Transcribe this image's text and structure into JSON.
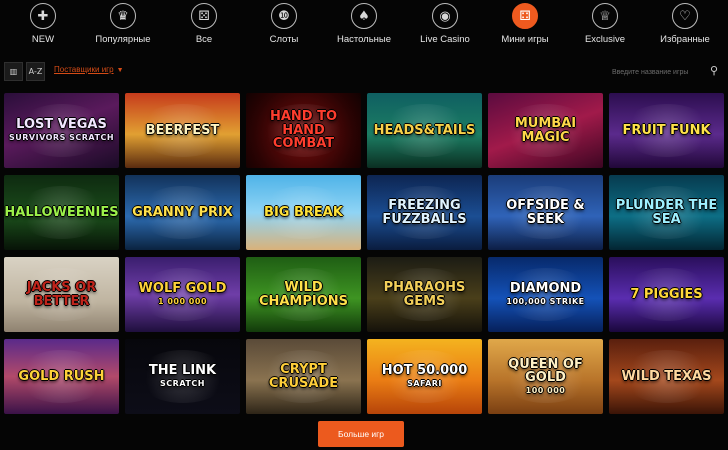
{
  "nav": {
    "items": [
      {
        "label": "NEW",
        "glyph": "✚"
      },
      {
        "label": "Популярные",
        "glyph": "♛"
      },
      {
        "label": "Все",
        "glyph": "⚄"
      },
      {
        "label": "Слоты",
        "glyph": "❿"
      },
      {
        "label": "Настольные",
        "glyph": "♠"
      },
      {
        "label": "Live Casino",
        "glyph": "◉"
      },
      {
        "label": "Мини игры",
        "glyph": "⚃"
      },
      {
        "label": "Exclusive",
        "glyph": "♕"
      },
      {
        "label": "Избранные",
        "glyph": "♡"
      }
    ],
    "active_index": 6,
    "accent_color": "#ee5a1f"
  },
  "toolbar": {
    "grid_view_icon": "grid-view-icon",
    "az_label": "A-Z",
    "sort_label": "Поставщики игр",
    "search_placeholder": "Введите название игры"
  },
  "games": [
    {
      "title": "Lost Vegas",
      "sub": "Survivors Scratch",
      "bg": "linear-gradient(160deg,#2a0e3a 0%,#5a1a5c 45%,#1a0b26 100%)",
      "color": "#f2e6ff"
    },
    {
      "title": "Beerfest",
      "sub": "",
      "bg": "linear-gradient(180deg,#c63b1c 0%,#e1a032 55%,#5a2b10 100%)",
      "color": "#fff4c0"
    },
    {
      "title": "Hand to Hand Combat",
      "sub": "",
      "bg": "radial-gradient(circle at 50% 55%,#7a0d0d 0%,#2b0303 70%,#120101 100%)",
      "color": "#ff3d2e"
    },
    {
      "title": "Heads&Tails",
      "sub": "",
      "bg": "linear-gradient(180deg,#0f5f62 0%,#1c7d63 55%,#0b2f22 100%)",
      "color": "#f7d24a"
    },
    {
      "title": "Mumbai Magic",
      "sub": "",
      "bg": "linear-gradient(160deg,#5b0b3f 0%,#a11a4a 50%,#3c0622 100%)",
      "color": "#ffd84a"
    },
    {
      "title": "Fruit Funk",
      "sub": "",
      "bg": "linear-gradient(180deg,#2c0e4f 0%,#5b2a8c 55%,#210838 100%)",
      "color": "#ffe24a"
    },
    {
      "title": "Halloweenies",
      "sub": "",
      "bg": "linear-gradient(180deg,#0e2a10 0%,#1b4d1b 55%,#071307 100%)",
      "color": "#9cf24a"
    },
    {
      "title": "Granny Prix",
      "sub": "",
      "bg": "linear-gradient(180deg,#12325a 0%,#2c6bb0 55%,#0b2340 100%)",
      "color": "#ffe14d"
    },
    {
      "title": "Big Break",
      "sub": "",
      "bg": "linear-gradient(180deg,#4fb3e8 0%,#8fd4f5 50%,#d9b27a 100%)",
      "color": "#ffe23a"
    },
    {
      "title": "Freezing Fuzzballs",
      "sub": "",
      "bg": "linear-gradient(180deg,#0d2552 0%,#1b4e93 55%,#0a1c3e 100%)",
      "color": "#dff3ff"
    },
    {
      "title": "Offside & Seek",
      "sub": "",
      "bg": "linear-gradient(180deg,#1b3d7a 0%,#2f63b8 55%,#0d1e45 100%)",
      "color": "#ffffff"
    },
    {
      "title": "Plunder the Sea",
      "sub": "",
      "bg": "linear-gradient(180deg,#073b4f 0%,#0d6e85 55%,#032532 100%)",
      "color": "#9ff0ff"
    },
    {
      "title": "Jacks or Better",
      "sub": "",
      "bg": "linear-gradient(180deg,#d9d2c4 0%,#bfb4a0 60%,#8f8270 100%)",
      "color": "#c0241b"
    },
    {
      "title": "Wolf Gold",
      "sub": "1 000 000",
      "bg": "linear-gradient(180deg,#3a1e6e 0%,#6f3ea8 50%,#1f0f3d 100%)",
      "color": "#ffd23a"
    },
    {
      "title": "Wild Champions",
      "sub": "",
      "bg": "linear-gradient(180deg,#1f5e14 0%,#3e9422 55%,#123a0b 100%)",
      "color": "#ffe14a"
    },
    {
      "title": "Pharaohs Gems",
      "sub": "",
      "bg": "linear-gradient(180deg,#1c1c14 0%,#4a3f1a 55%,#15120a 100%)",
      "color": "#f2cf5a"
    },
    {
      "title": "Diamond",
      "sub": "100,000 Strike",
      "bg": "linear-gradient(180deg,#07296b 0%,#1452b8 55%,#06205a 100%)",
      "color": "#ffffff"
    },
    {
      "title": "7 Piggies",
      "sub": "",
      "bg": "linear-gradient(180deg,#2a0f5c 0%,#5a2db0 55%,#1a073c 100%)",
      "color": "#ffd83a"
    },
    {
      "title": "Gold Rush",
      "sub": "",
      "bg": "linear-gradient(180deg,#5a2a8a 0%,#b24a6a 50%,#3a1248 100%)",
      "color": "#ffd23a"
    },
    {
      "title": "The Link",
      "sub": "Scratch",
      "bg": "linear-gradient(180deg,#07070c 0%,#0d0d18 100%)",
      "color": "#ffffff"
    },
    {
      "title": "Crypt Crusade",
      "sub": "",
      "bg": "linear-gradient(180deg,#5a4a38 0%,#8a7350 55%,#2e2518 100%)",
      "color": "#ffcf3a"
    },
    {
      "title": "Hot 50.000",
      "sub": "Safari",
      "bg": "linear-gradient(180deg,#f4b31f 0%,#ea7d14 55%,#b64409 100%)",
      "color": "#ffffff"
    },
    {
      "title": "Queen of Gold",
      "sub": "100 000",
      "bg": "linear-gradient(180deg,#e0a84a 0%,#b8742a 55%,#7a3f12 100%)",
      "color": "#fff1c6"
    },
    {
      "title": "Wild Texas",
      "sub": "",
      "bg": "linear-gradient(180deg,#5a1f0e 0%,#a4481c 55%,#3a1407 100%)",
      "color": "#ffd9a0"
    }
  ],
  "more_button_label": "Больше игр"
}
